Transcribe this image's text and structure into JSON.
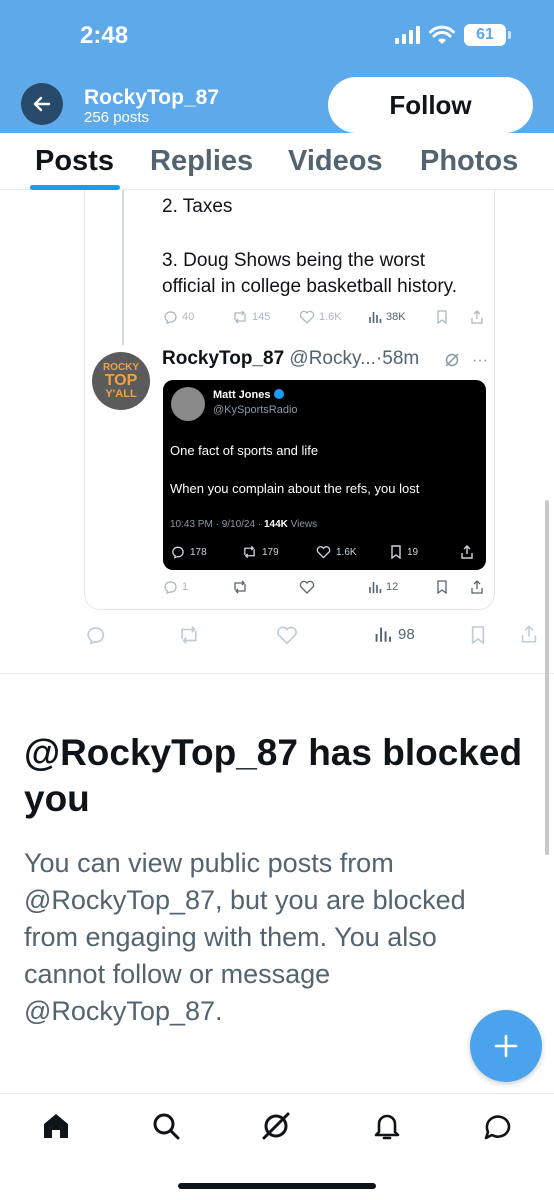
{
  "status_bar": {
    "time": "2:48",
    "battery": "61"
  },
  "header": {
    "account_name": "RockyTop_87",
    "post_count": "256 posts",
    "follow_label": "Follow"
  },
  "tabs": [
    {
      "label": "Posts",
      "active": true
    },
    {
      "label": "Replies",
      "active": false
    },
    {
      "label": "Videos",
      "active": false
    },
    {
      "label": "Photos",
      "active": false
    }
  ],
  "quoted_tweet": {
    "lines": [
      "2. Taxes",
      "3. Doug Shows being the worst",
      "official in college basketball history."
    ],
    "actions": {
      "replies": "40",
      "reposts": "145",
      "likes": "1.6K",
      "views": "38K"
    }
  },
  "tweet": {
    "avatar_text": [
      "ROCKY",
      "TOP",
      "Y'ALL"
    ],
    "name": "RockyTop_87",
    "handle_time": "@Rocky...·58m",
    "more": "···",
    "embed": {
      "name": "Matt Jones",
      "handle": "@KySportsRadio",
      "text1": "One fact of sports and life",
      "text2": "When you complain about the refs, you lost",
      "meta_prefix": "10:43 PM · 9/10/24 · ",
      "views_bold": "144K",
      "views_suffix": " Views",
      "actions": {
        "replies": "178",
        "reposts": "179",
        "likes": "1.6K",
        "bookmarks": "19"
      }
    },
    "actions": {
      "replies": "1",
      "views": "12"
    }
  },
  "outer_actions": {
    "views": "98"
  },
  "blocked": {
    "title": "@RockyTop_87 has blocked you",
    "body": "You can view public posts from @RockyTop_87, but you are blocked from engaging with them. You also cannot follow or message @RockyTop_87."
  },
  "colors": {
    "header_bg": "#5da9ea",
    "accent": "#1d9bf0",
    "fab": "#4aa3ec"
  },
  "icons": [
    "back-arrow-icon",
    "wifi-icon",
    "signal-icon",
    "reply-icon",
    "repost-icon",
    "like-icon",
    "views-icon",
    "bookmark-icon",
    "share-icon",
    "grok-icon",
    "plus-icon",
    "home-icon",
    "search-icon",
    "bell-icon",
    "messages-icon"
  ]
}
